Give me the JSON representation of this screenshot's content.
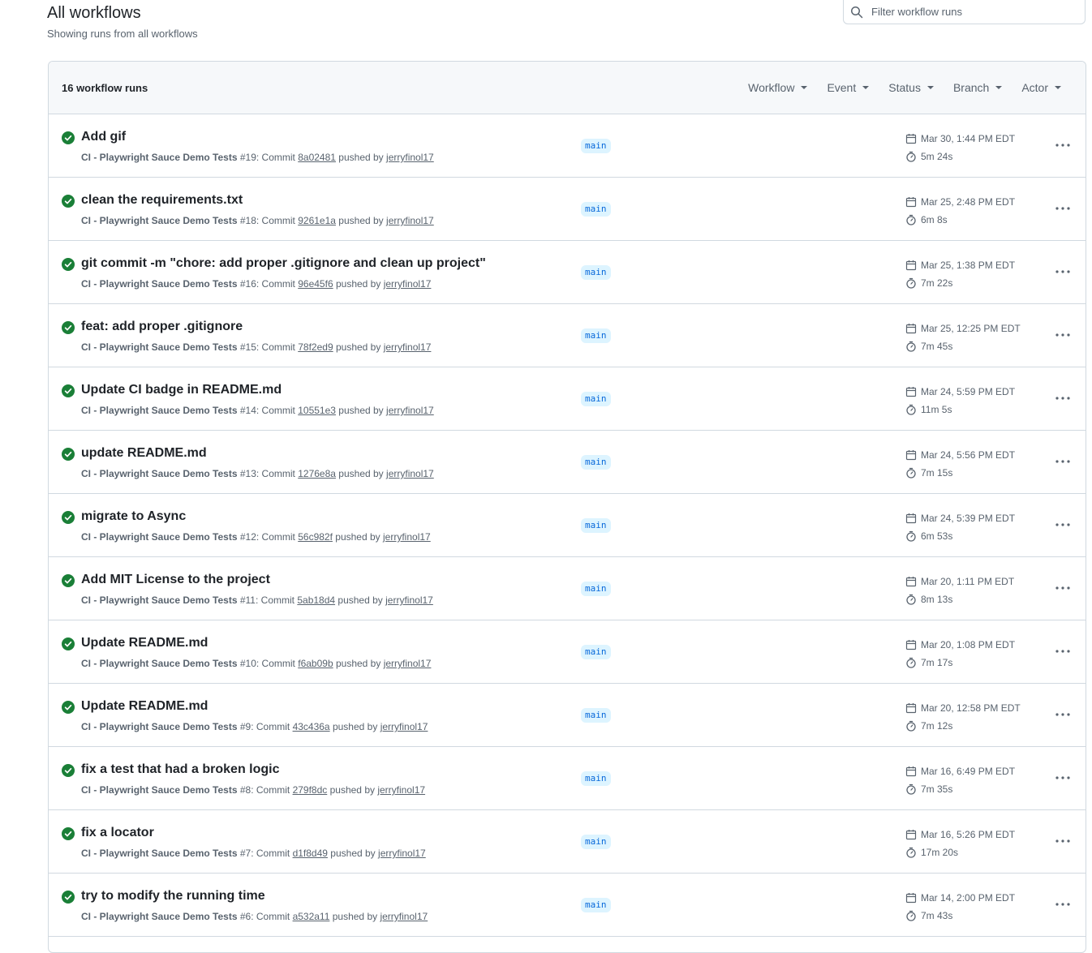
{
  "header": {
    "title": "All workflows",
    "subtitle": "Showing runs from all workflows"
  },
  "search": {
    "placeholder": "Filter workflow runs"
  },
  "list": {
    "count_label": "16 workflow runs",
    "filters": [
      "Workflow",
      "Event",
      "Status",
      "Branch",
      "Actor"
    ]
  },
  "colors": {
    "success": "#1a7f37",
    "branch_text": "#0969da",
    "branch_bg": "#ddf4ff"
  },
  "runs": [
    {
      "title": "Add gif",
      "workflow": "CI - Playwright Sauce Demo Tests",
      "run_number": "#19",
      "commit": "8a02481",
      "actor": "jerryfinol17",
      "branch": "main",
      "date": "Mar 30, 1:44 PM EDT",
      "duration": "5m 24s"
    },
    {
      "title": "clean the requirements.txt",
      "workflow": "CI - Playwright Sauce Demo Tests",
      "run_number": "#18",
      "commit": "9261e1a",
      "actor": "jerryfinol17",
      "branch": "main",
      "date": "Mar 25, 2:48 PM EDT",
      "duration": "6m 8s"
    },
    {
      "title": "git commit -m \"chore: add proper .gitignore and clean up project\"",
      "workflow": "CI - Playwright Sauce Demo Tests",
      "run_number": "#16",
      "commit": "96e45f6",
      "actor": "jerryfinol17",
      "branch": "main",
      "date": "Mar 25, 1:38 PM EDT",
      "duration": "7m 22s"
    },
    {
      "title": "feat: add proper .gitignore",
      "workflow": "CI - Playwright Sauce Demo Tests",
      "run_number": "#15",
      "commit": "78f2ed9",
      "actor": "jerryfinol17",
      "branch": "main",
      "date": "Mar 25, 12:25 PM EDT",
      "duration": "7m 45s"
    },
    {
      "title": "Update CI badge in README.md",
      "workflow": "CI - Playwright Sauce Demo Tests",
      "run_number": "#14",
      "commit": "10551e3",
      "actor": "jerryfinol17",
      "branch": "main",
      "date": "Mar 24, 5:59 PM EDT",
      "duration": "11m 5s"
    },
    {
      "title": "update README.md",
      "workflow": "CI - Playwright Sauce Demo Tests",
      "run_number": "#13",
      "commit": "1276e8a",
      "actor": "jerryfinol17",
      "branch": "main",
      "date": "Mar 24, 5:56 PM EDT",
      "duration": "7m 15s"
    },
    {
      "title": "migrate to Async",
      "workflow": "CI - Playwright Sauce Demo Tests",
      "run_number": "#12",
      "commit": "56c982f",
      "actor": "jerryfinol17",
      "branch": "main",
      "date": "Mar 24, 5:39 PM EDT",
      "duration": "6m 53s"
    },
    {
      "title": "Add MIT License to the project",
      "workflow": "CI - Playwright Sauce Demo Tests",
      "run_number": "#11",
      "commit": "5ab18d4",
      "actor": "jerryfinol17",
      "branch": "main",
      "date": "Mar 20, 1:11 PM EDT",
      "duration": "8m 13s"
    },
    {
      "title": "Update README.md",
      "workflow": "CI - Playwright Sauce Demo Tests",
      "run_number": "#10",
      "commit": "f6ab09b",
      "actor": "jerryfinol17",
      "branch": "main",
      "date": "Mar 20, 1:08 PM EDT",
      "duration": "7m 17s"
    },
    {
      "title": "Update README.md",
      "workflow": "CI - Playwright Sauce Demo Tests",
      "run_number": "#9",
      "commit": "43c436a",
      "actor": "jerryfinol17",
      "branch": "main",
      "date": "Mar 20, 12:58 PM EDT",
      "duration": "7m 12s"
    },
    {
      "title": "fix a test that had a broken logic",
      "workflow": "CI - Playwright Sauce Demo Tests",
      "run_number": "#8",
      "commit": "279f8dc",
      "actor": "jerryfinol17",
      "branch": "main",
      "date": "Mar 16, 6:49 PM EDT",
      "duration": "7m 35s"
    },
    {
      "title": "fix a locator",
      "workflow": "CI - Playwright Sauce Demo Tests",
      "run_number": "#7",
      "commit": "d1f8d49",
      "actor": "jerryfinol17",
      "branch": "main",
      "date": "Mar 16, 5:26 PM EDT",
      "duration": "17m 20s"
    },
    {
      "title": "try to modify the running time",
      "workflow": "CI - Playwright Sauce Demo Tests",
      "run_number": "#6",
      "commit": "a532a11",
      "actor": "jerryfinol17",
      "branch": "main",
      "date": "Mar 14, 2:00 PM EDT",
      "duration": "7m 43s"
    }
  ],
  "meta_words": {
    "commit": "Commit",
    "pushed_by": "pushed by"
  }
}
